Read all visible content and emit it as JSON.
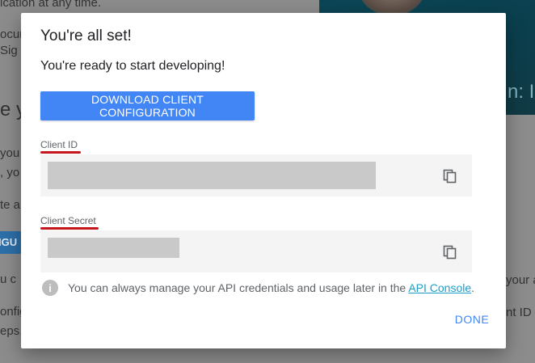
{
  "background": {
    "fragments": [
      "ication at any time.",
      "ocum",
      "Sig",
      "e y",
      "you",
      ", yo",
      "te a",
      "IGU",
      "u c",
      "onfig",
      "eps.",
      "n: In",
      "your a",
      "nt ID"
    ]
  },
  "dialog": {
    "title": "You're all set!",
    "subtitle": "You're ready to start developing!",
    "download_button": "DOWNLOAD CLIENT CONFIGURATION",
    "client_id": {
      "label": "Client ID",
      "value": ""
    },
    "client_secret": {
      "label": "Client Secret",
      "value": ""
    },
    "info": {
      "text": "You can always manage your API credentials and usage later in the ",
      "link": "API Console",
      "suffix": "."
    },
    "done_button": "DONE"
  },
  "colors": {
    "accent": "#4285f4",
    "link": "#1a9ec9",
    "annotation": "#c4161c",
    "overlay": "#8c8c8c"
  },
  "icons": [
    "copy-icon",
    "info-icon"
  ]
}
